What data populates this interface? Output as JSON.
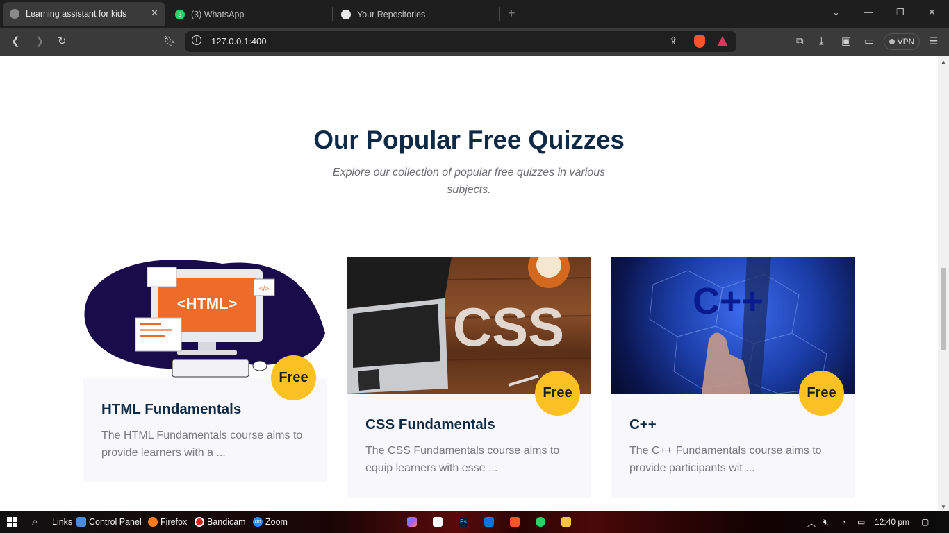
{
  "browser": {
    "tabs": [
      {
        "label": "Learning assistant for kids",
        "active": true
      },
      {
        "label": "(3) WhatsApp",
        "active": false,
        "badge": "3"
      },
      {
        "label": "Your Repositories",
        "active": false
      }
    ],
    "new_tab": "+",
    "url": "127.0.0.1:400",
    "vpn_label": "VPN"
  },
  "section": {
    "title": "Our Popular Free Quizzes",
    "subtitle": "Explore our collection of popular free quizzes in various subjects."
  },
  "cards": [
    {
      "title": "HTML Fundamentals",
      "description": "The HTML Fundamentals course aims to provide learners with a ...",
      "badge": "Free",
      "image_text": "<HTML>",
      "image_code": "</>"
    },
    {
      "title": "CSS Fundamentals",
      "description": "The CSS Fundamentals course aims to equip learners with esse ...",
      "badge": "Free",
      "image_text": "CSS"
    },
    {
      "title": "C++",
      "description": "The C++ Fundamentals course aims to provide participants wit ...",
      "badge": "Free",
      "image_text": "C++"
    }
  ],
  "taskbar": {
    "links": "Links",
    "control_panel": "Control Panel",
    "firefox": "Firefox",
    "bandicam": "Bandicam",
    "zoom": "Zoom",
    "zoom_icon": "zm",
    "ps_icon": "Ps",
    "clock": "12:40 pm"
  },
  "colors": {
    "title": "#0e2a47",
    "badge": "#fbc122",
    "card_bg": "#f7f7fc",
    "html_orange": "#ef6b2a",
    "cpp_blue": "#1b3ea8"
  }
}
